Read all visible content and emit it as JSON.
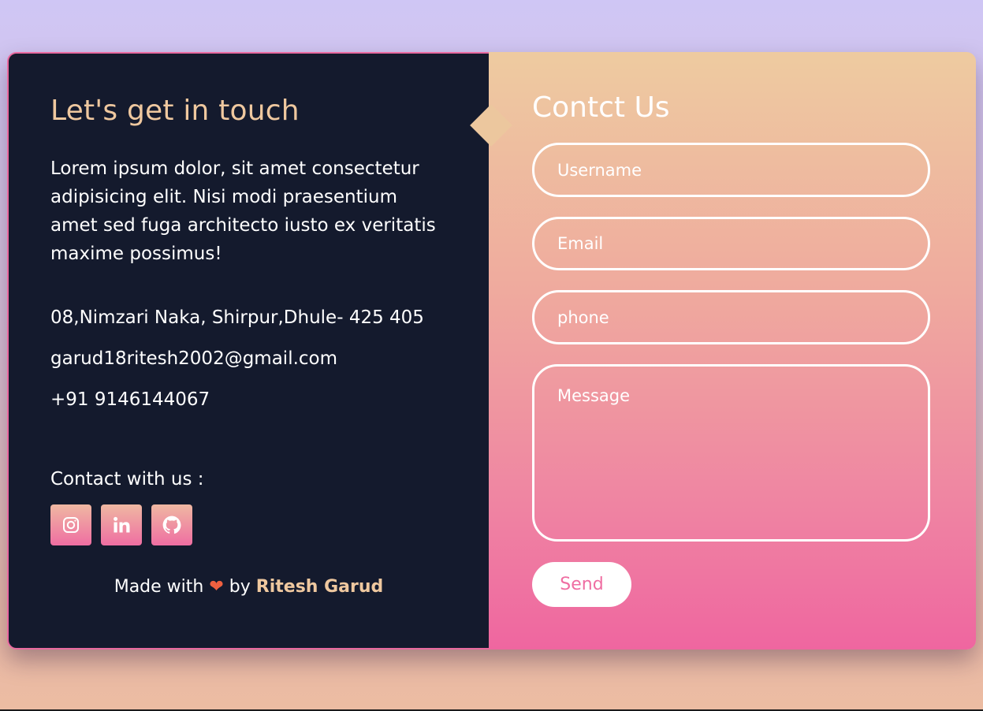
{
  "left": {
    "heading": "Let's get in touch",
    "description": "Lorem ipsum dolor, sit amet consectetur adipisicing elit. Nisi modi praesentium amet sed fuga architecto iusto ex veritatis maxime possimus!",
    "address": "08,Nimzari Naka, Shirpur,Dhule- 425 405",
    "email": "garud18ritesh2002@gmail.com",
    "phone": "+91 9146144067",
    "contact_with_label": "Contact with us :",
    "social": [
      {
        "icon": "instagram-icon"
      },
      {
        "icon": "linkedin-icon"
      },
      {
        "icon": "github-icon"
      }
    ],
    "footer": {
      "made_with": "Made with",
      "heart": "❤",
      "by": "by",
      "author": "Ritesh Garud"
    }
  },
  "right": {
    "heading": "Contct Us",
    "fields": {
      "username_placeholder": "Username",
      "email_placeholder": "Email",
      "phone_placeholder": "phone",
      "message_placeholder": "Message"
    },
    "send_label": "Send"
  },
  "colors": {
    "left_bg": "#141a2d",
    "accent_peach": "#efc89f",
    "accent_pink": "#ef6ea2",
    "heart": "#f06040"
  }
}
